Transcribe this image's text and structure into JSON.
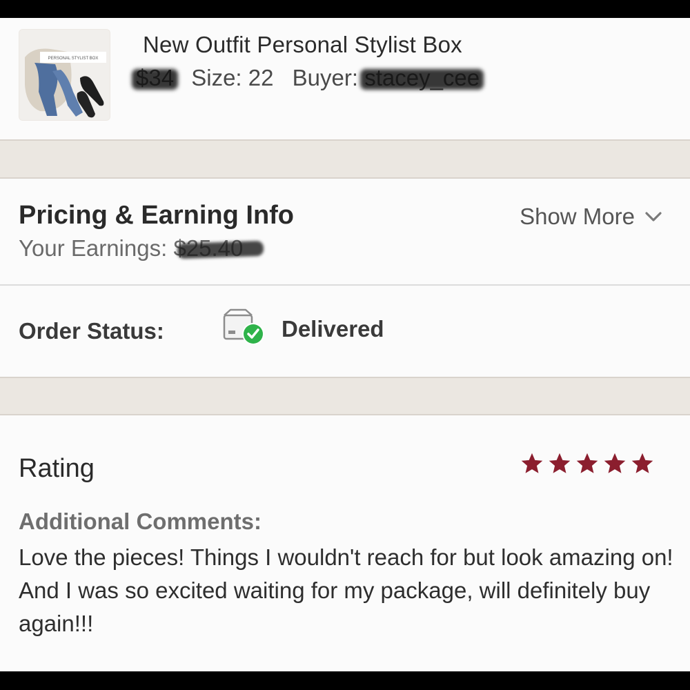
{
  "product": {
    "image_label": "PERSONAL STYLIST BOX",
    "title": "New Outfit Personal Stylist Box",
    "price": "$34",
    "size": "Size: 22",
    "buyer_label": "Buyer:",
    "buyer_value": "stacey_cee"
  },
  "pricing": {
    "title": "Pricing & Earning Info",
    "earnings_label": "Your Earnings: ",
    "earnings_value": "$25.40",
    "show_more": "Show More"
  },
  "status": {
    "label": "Order Status:",
    "value": "Delivered"
  },
  "rating": {
    "title": "Rating",
    "stars": 5,
    "star_color": "#8b1e2e",
    "comments_label": "Additional Comments:",
    "comments": "Love the pieces! Things I wouldn't reach for but look amazing on! And I was so excited waiting for my package, will definitely buy again!!!"
  },
  "colors": {
    "delivered_check": "#2fb34a"
  }
}
